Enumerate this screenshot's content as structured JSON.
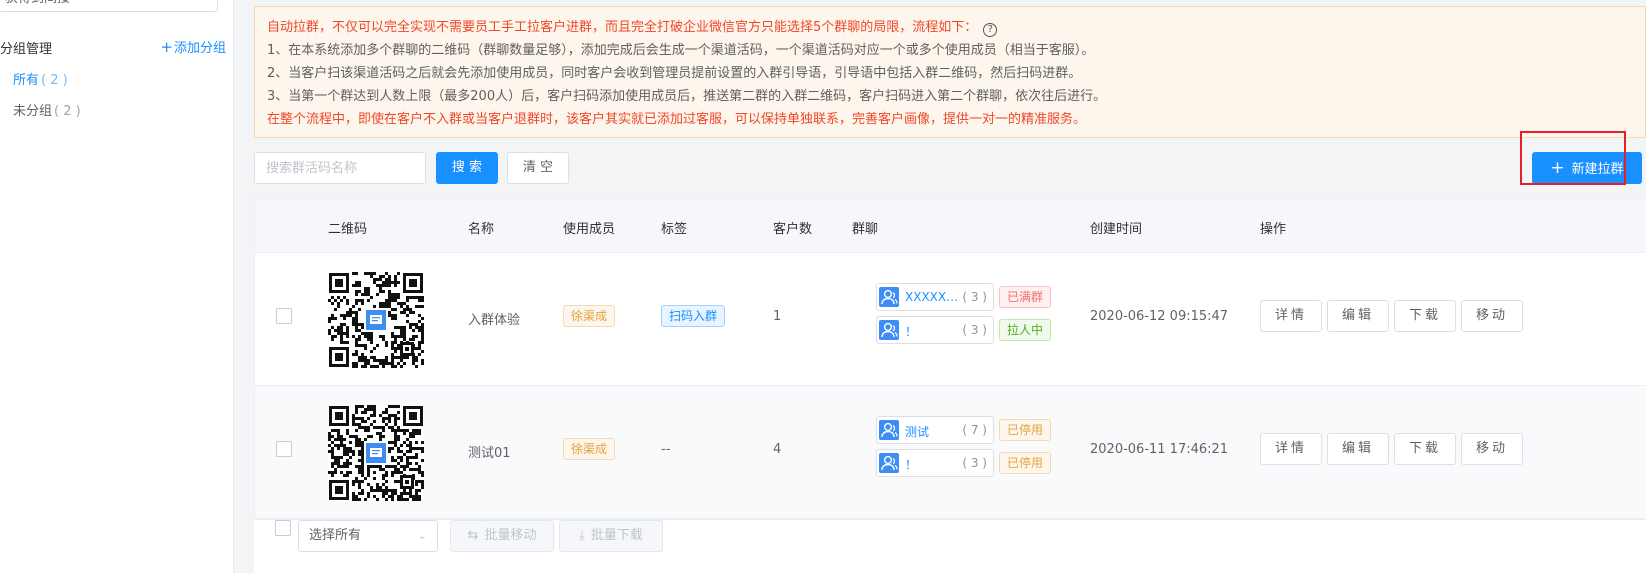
{
  "sidebar": {
    "search_value": "获得到间接",
    "group_title": "分组管理",
    "add_group": "添加分组",
    "items": [
      {
        "label": "所有",
        "count": "( 2 )"
      },
      {
        "label": "未分组",
        "count": "( 2 )"
      }
    ]
  },
  "notice": {
    "lines": [
      "自动拉群，不仅可以完全实现不需要员工手工拉客户进群，而且完全打破企业微信官方只能选择5个群聊的局限，流程如下：",
      "1、在本系统添加多个群聊的二维码（群聊数量足够），添加完成后会生成一个渠道活码，一个渠道活码对应一个或多个使用成员（相当于客服）。",
      "2、当客户扫该渠道活码之后就会先添加使用成员，同时客户会收到管理员提前设置的入群引导语，引导语中包括入群二维码，然后扫码进群。",
      "3、当第一个群达到人数上限（最多200人）后，客户扫码添加使用成员后，推送第二群的入群二维码，客户扫码进入第二个群聊，依次往后进行。",
      "在整个流程中，即使在客户不入群或当客户退群时，该客户其实就已添加过客服，可以保持单独联系，完善客户画像，提供一对一的精准服务。"
    ],
    "help_icon": "?"
  },
  "toolbar": {
    "search_placeholder": "搜索群活码名称",
    "search_label": "搜 索",
    "clear_label": "清 空",
    "new_label": "新建拉群",
    "new_icon": "+"
  },
  "table": {
    "headers": {
      "qrcode": "二维码",
      "name": "名称",
      "members": "使用成员",
      "tags": "标签",
      "customers": "客户数",
      "groups": "群聊",
      "created": "创建时间",
      "actions": "操作"
    },
    "rows": [
      {
        "name": "入群体验",
        "member": "徐渠成",
        "tag": "扫码入群",
        "customers": "1",
        "groups": [
          {
            "name": "XXXXXXX...",
            "count": "( 3 )",
            "status": "已满群",
            "status_color": "red"
          },
          {
            "name": "！",
            "count": "( 3 )",
            "status": "拉人中",
            "status_color": "green"
          }
        ],
        "created": "2020-06-12 09:15:47"
      },
      {
        "name": "测试01",
        "member": "徐渠成",
        "tag": "--",
        "customers": "4",
        "groups": [
          {
            "name": "测试",
            "count": "( 7 )",
            "status": "已停用",
            "status_color": "orange"
          },
          {
            "name": "！",
            "count": "( 3 )",
            "status": "已停用",
            "status_color": "orange"
          }
        ],
        "created": "2020-06-11 17:46:21"
      }
    ],
    "actions": [
      "详情",
      "编辑",
      "下载",
      "移动"
    ]
  },
  "footer": {
    "select_all": "选择所有",
    "batch_move": "批量移动",
    "batch_download": "批量下载"
  },
  "colors": {
    "primary": "#1890ff",
    "notice_bg": "#fdf6ec",
    "notice_red": "#f0472b",
    "highlight": "#e5202a"
  }
}
